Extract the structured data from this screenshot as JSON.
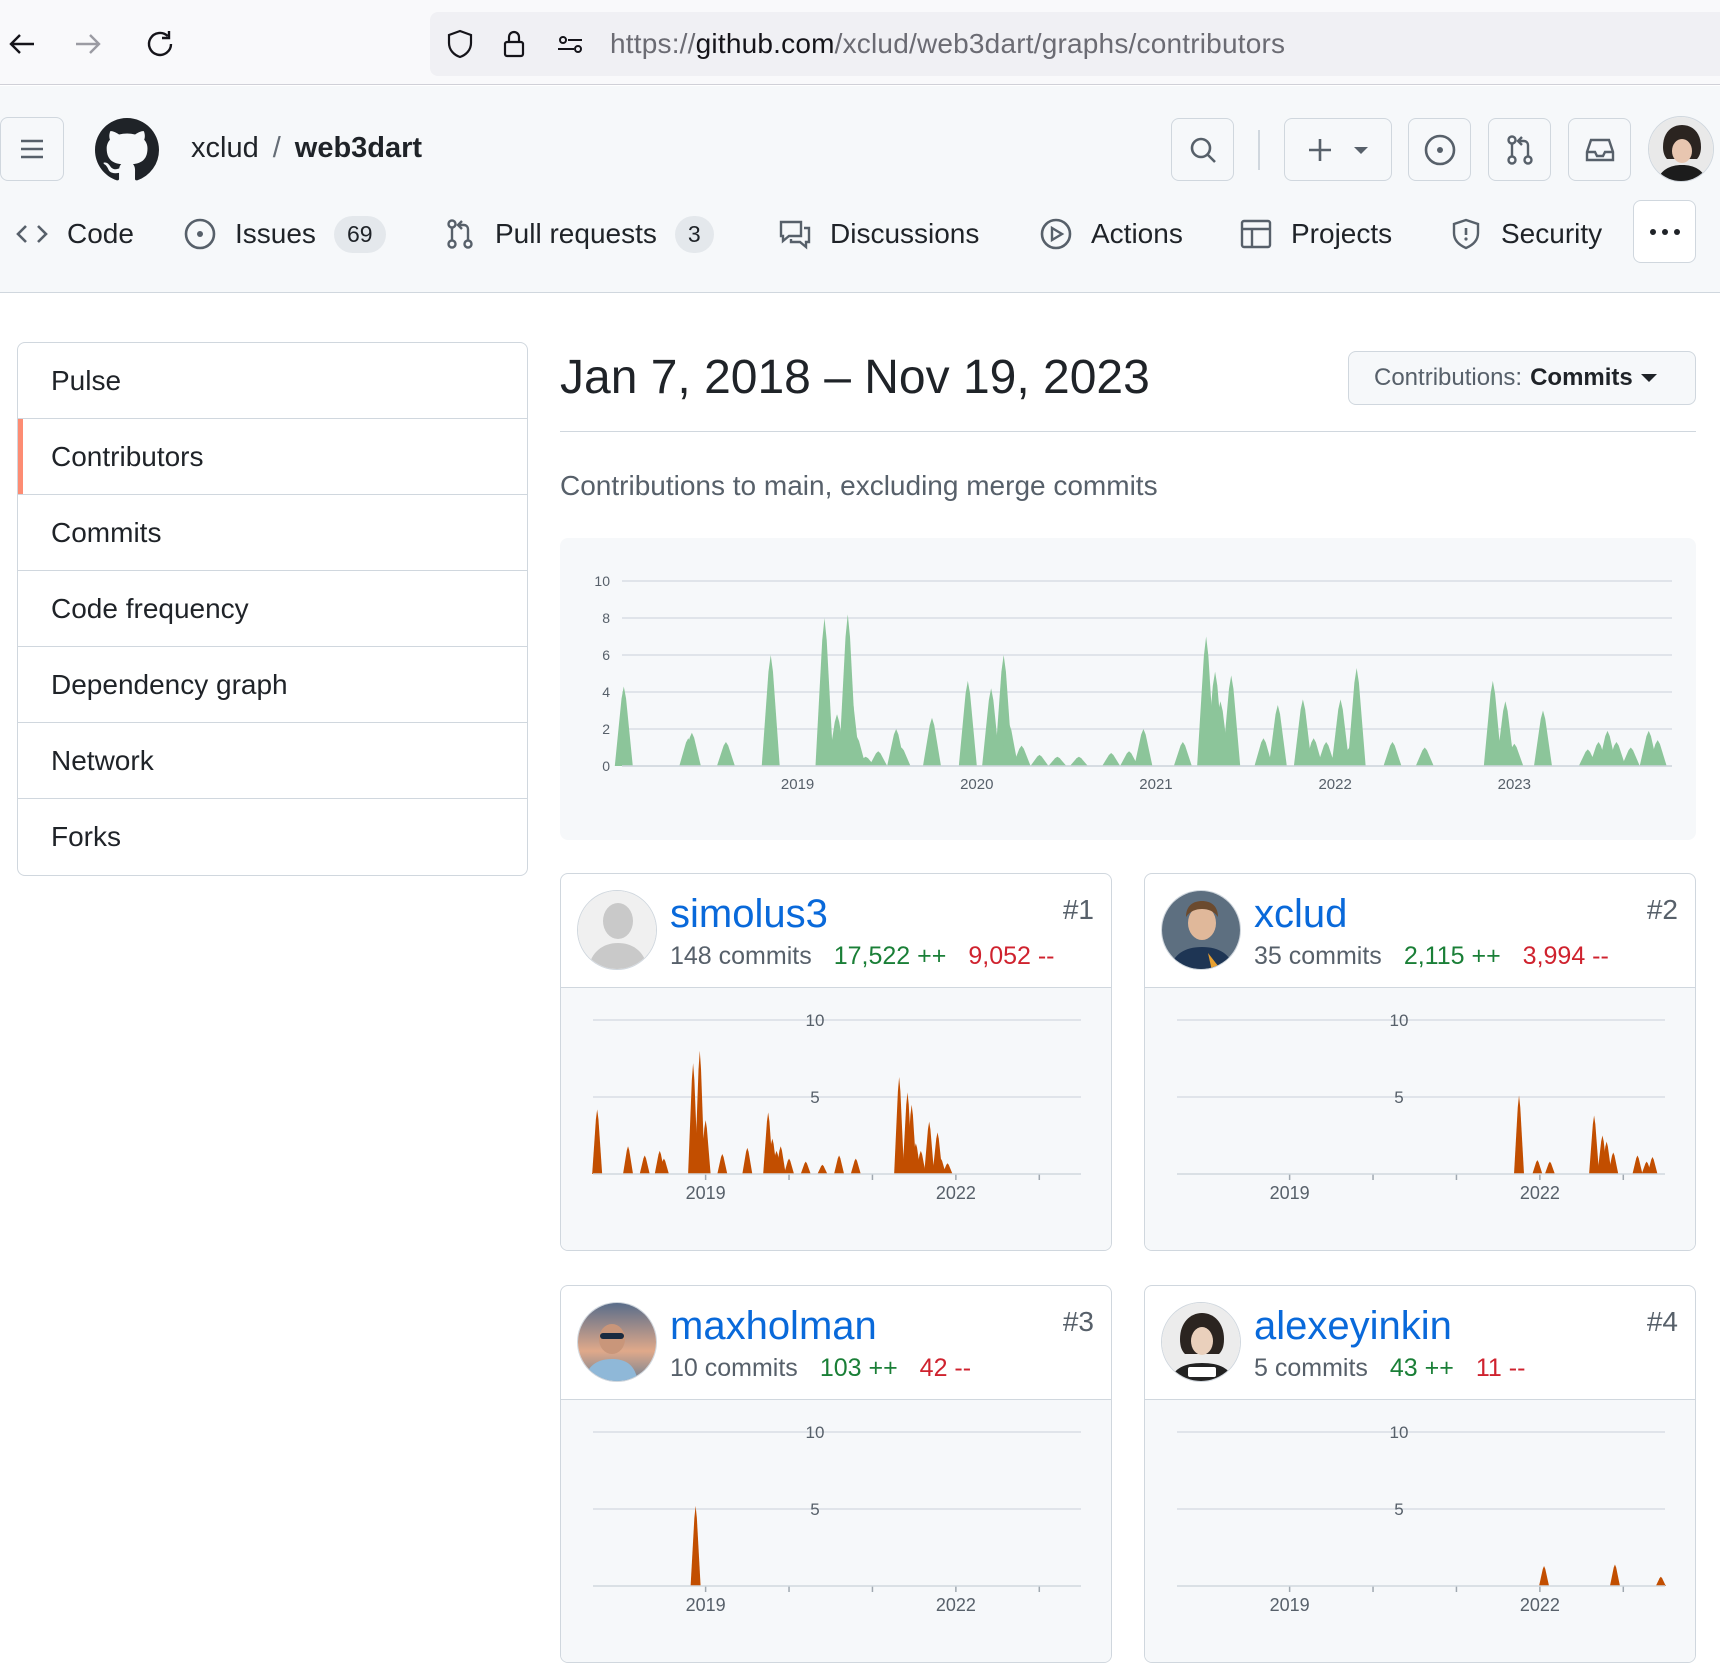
{
  "browser": {
    "url_prefix": "https://",
    "url_domain": "github.com",
    "url_path": "/xclud/web3dart/graphs/contributors"
  },
  "header": {
    "owner": "xclud",
    "separator": "/",
    "repo": "web3dart"
  },
  "tabs": [
    {
      "label": "Code",
      "icon": "code-icon"
    },
    {
      "label": "Issues",
      "count": "69",
      "icon": "issue-icon"
    },
    {
      "label": "Pull requests",
      "count": "3",
      "icon": "pull-request-icon"
    },
    {
      "label": "Discussions",
      "icon": "discussions-icon"
    },
    {
      "label": "Actions",
      "icon": "play-icon"
    },
    {
      "label": "Projects",
      "icon": "table-icon"
    },
    {
      "label": "Security",
      "icon": "shield-icon"
    }
  ],
  "sidebar": {
    "items": [
      {
        "label": "Pulse"
      },
      {
        "label": "Contributors",
        "active": true
      },
      {
        "label": "Commits"
      },
      {
        "label": "Code frequency"
      },
      {
        "label": "Dependency graph"
      },
      {
        "label": "Network"
      },
      {
        "label": "Forks"
      }
    ]
  },
  "main": {
    "date_range": "Jan 7, 2018 – Nov 19, 2023",
    "select_prefix": "Contributions:",
    "select_value": "Commits",
    "subtitle": "Contributions to main, excluding merge commits"
  },
  "colors": {
    "overview_fill": "#8cc59a",
    "contributor_fill": "#c24e00",
    "link": "#0969da",
    "additions": "#1a7f37",
    "deletions": "#cf222e"
  },
  "chart_data": [
    {
      "type": "area",
      "title": "Contributions to main, excluding merge commits",
      "ylim": [
        0,
        10
      ],
      "yticks": [
        "0",
        "2",
        "4",
        "6",
        "8",
        "10"
      ],
      "xticks": [
        "2019",
        "2020",
        "2021",
        "2022",
        "2023"
      ],
      "xlim": [
        2018.02,
        2023.88
      ],
      "grid": true,
      "x": [
        2018.03,
        2018.39,
        2018.41,
        2018.6,
        2018.85,
        2019.15,
        2019.22,
        2019.28,
        2019.3,
        2019.33,
        2019.38,
        2019.45,
        2019.55,
        2019.58,
        2019.75,
        2019.95,
        2020.08,
        2020.15,
        2020.18,
        2020.25,
        2020.35,
        2020.45,
        2020.57,
        2020.75,
        2020.85,
        2020.93,
        2021.15,
        2021.28,
        2021.33,
        2021.36,
        2021.42,
        2021.6,
        2021.68,
        2021.82,
        2021.88,
        2021.95,
        2022.03,
        2022.08,
        2022.12,
        2022.32,
        2022.5,
        2022.88,
        2022.95,
        2023.0,
        2023.16,
        2023.41,
        2023.47,
        2023.52,
        2023.57,
        2023.65,
        2023.75,
        2023.8
      ],
      "values": [
        4.3,
        1.5,
        1.8,
        1.3,
        6.0,
        8.0,
        2.8,
        8.2,
        3.8,
        1.6,
        0.5,
        0.8,
        2.0,
        1.0,
        2.6,
        4.6,
        4.2,
        6.0,
        2.3,
        1.1,
        0.6,
        0.5,
        0.5,
        0.7,
        0.8,
        2.0,
        1.3,
        7.0,
        5.1,
        3.5,
        4.9,
        1.5,
        3.3,
        3.6,
        1.5,
        1.3,
        3.6,
        1.0,
        5.3,
        1.3,
        1.0,
        4.6,
        3.5,
        1.2,
        3.0,
        0.9,
        1.3,
        1.9,
        1.3,
        1.0,
        1.9,
        1.4
      ]
    },
    {
      "type": "area",
      "title": "simolus3",
      "ylim": [
        0,
        10
      ],
      "yticks": [
        "5",
        "10"
      ],
      "xticks": [
        "2019",
        "2022"
      ],
      "xlim": [
        2017.65,
        2023.5
      ],
      "grid": true,
      "x": [
        2017.7,
        2018.07,
        2018.27,
        2018.45,
        2018.5,
        2018.85,
        2018.93,
        2019.0,
        2019.2,
        2019.5,
        2019.75,
        2019.8,
        2019.85,
        2019.9,
        2020.0,
        2020.2,
        2020.4,
        2020.6,
        2020.8,
        2021.32,
        2021.42,
        2021.47,
        2021.52,
        2021.58,
        2021.68,
        2021.78,
        2021.82,
        2021.9
      ],
      "values": [
        4.2,
        1.8,
        1.2,
        1.5,
        1.0,
        7.2,
        8.0,
        3.5,
        1.3,
        1.7,
        4.0,
        2.3,
        1.5,
        1.8,
        1.0,
        0.8,
        0.6,
        1.2,
        1.0,
        6.3,
        5.3,
        4.5,
        2.0,
        1.5,
        3.4,
        2.7,
        1.0,
        0.7
      ]
    },
    {
      "type": "area",
      "title": "xclud",
      "ylim": [
        0,
        10
      ],
      "yticks": [
        "5",
        "10"
      ],
      "xticks": [
        "2019",
        "2022"
      ],
      "xlim": [
        2017.65,
        2023.5
      ],
      "grid": true,
      "x": [
        2021.75,
        2021.97,
        2022.12,
        2022.65,
        2022.75,
        2022.8,
        2022.88,
        2023.17,
        2023.28,
        2023.35
      ],
      "values": [
        5.1,
        0.9,
        0.8,
        3.8,
        2.5,
        2.1,
        1.4,
        1.2,
        0.8,
        1.1
      ]
    },
    {
      "type": "area",
      "title": "maxholman",
      "ylim": [
        0,
        10
      ],
      "yticks": [
        "5",
        "10"
      ],
      "xticks": [
        "2019",
        "2022"
      ],
      "xlim": [
        2017.65,
        2023.5
      ],
      "grid": true,
      "x": [
        2018.88
      ],
      "values": [
        5.2
      ]
    },
    {
      "type": "area",
      "title": "alexeyinkin",
      "ylim": [
        0,
        10
      ],
      "yticks": [
        "5",
        "10"
      ],
      "xticks": [
        "2019",
        "2022"
      ],
      "xlim": [
        2017.65,
        2023.5
      ],
      "grid": true,
      "x": [
        2022.05,
        2022.9,
        2023.45
      ],
      "values": [
        1.3,
        1.4,
        0.6
      ]
    }
  ],
  "contributors": [
    {
      "name": "simolus3",
      "rank": "#1",
      "commits": "148 commits",
      "additions": "17,522 ++",
      "deletions": "9,052 --"
    },
    {
      "name": "xclud",
      "rank": "#2",
      "commits": "35 commits",
      "additions": "2,115 ++",
      "deletions": "3,994 --"
    },
    {
      "name": "maxholman",
      "rank": "#3",
      "commits": "10 commits",
      "additions": "103 ++",
      "deletions": "42 --"
    },
    {
      "name": "alexeyinkin",
      "rank": "#4",
      "commits": "5 commits",
      "additions": "43 ++",
      "deletions": "11 --"
    }
  ]
}
